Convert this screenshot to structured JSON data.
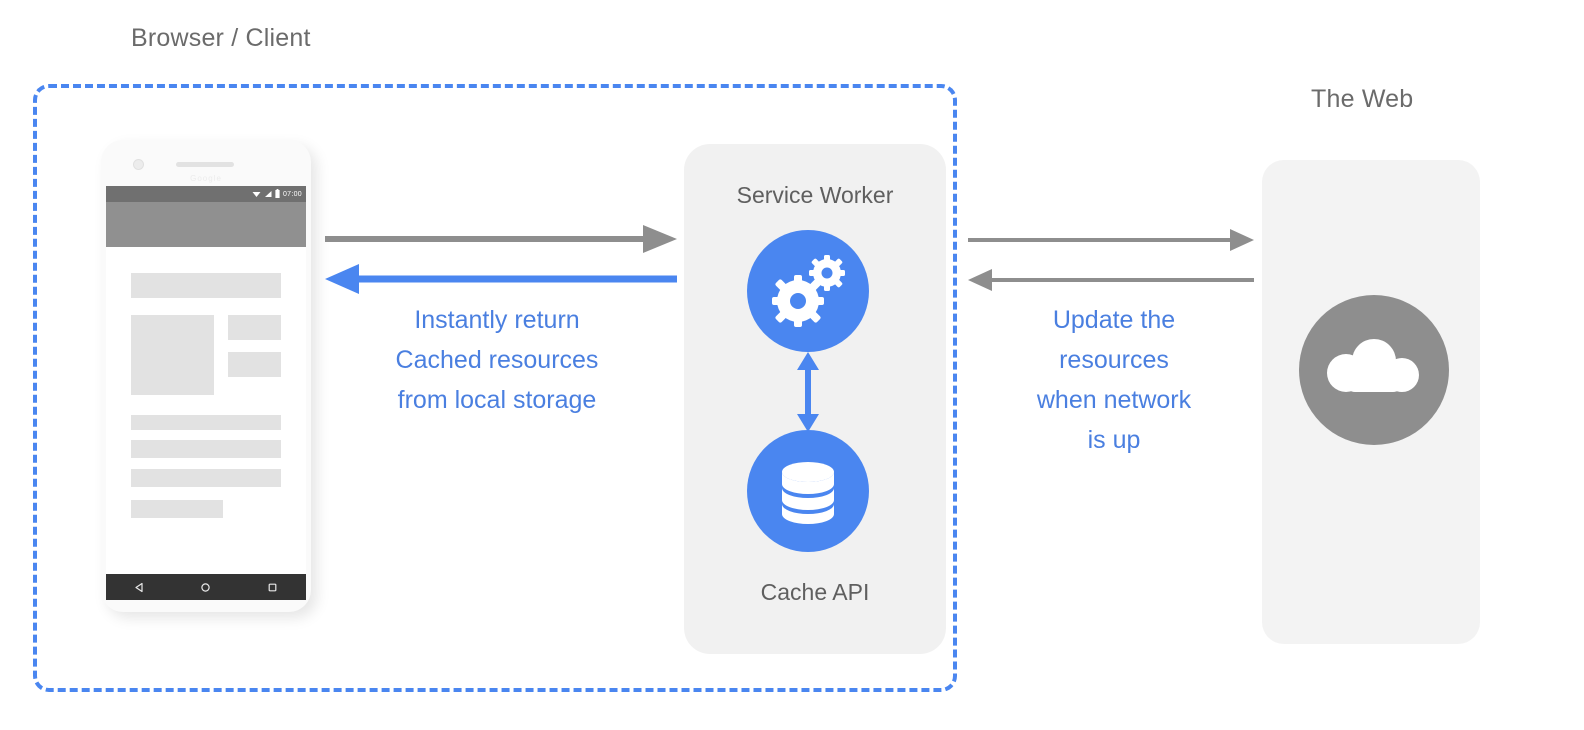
{
  "diagram": {
    "title_browser": "Browser / Client",
    "title_web": "The Web"
  },
  "service_worker": {
    "title": "Service Worker",
    "cache_title": "Cache API",
    "gears_icon": "gears-icon",
    "database_icon": "database-icon",
    "link_icon": "vertical-double-arrow-icon"
  },
  "web": {
    "cloud_icon": "cloud-icon"
  },
  "annotations": {
    "left": "Instantly return\nCached resources\nfrom local storage",
    "right": "Update the\nresources\nwhen network\nis up"
  },
  "arrows": {
    "client_to_sw": "arrow-right-gray",
    "sw_to_client": "arrow-left-blue",
    "sw_to_web": "arrow-right-gray",
    "web_to_sw": "arrow-left-gray"
  },
  "phone": {
    "status_time": "07:00",
    "wifi_icon": "wifi-icon",
    "signal_icon": "signal-icon",
    "battery_icon": "battery-icon",
    "nav_back_icon": "back-triangle-icon",
    "nav_home_icon": "home-circle-icon",
    "nav_recents_icon": "recents-square-icon",
    "brand": "Google"
  },
  "colors": {
    "blue": "#4a86f0",
    "blue_text": "#4a7fe0",
    "gray_arrow": "#8e8e8e",
    "panel_gray": "#f1f1f1",
    "label_gray": "#6b6b6b"
  }
}
